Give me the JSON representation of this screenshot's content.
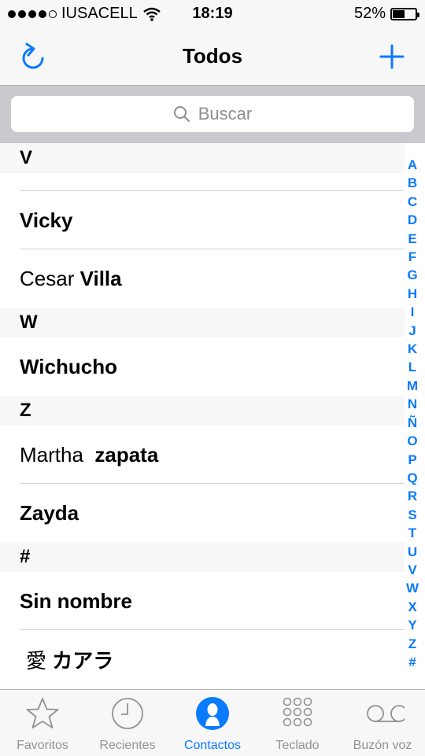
{
  "status": {
    "carrier": "IUSACELL",
    "time": "18:19",
    "battery": "52%",
    "battery_level": 0.52
  },
  "nav": {
    "title": "Todos"
  },
  "search": {
    "placeholder": "Buscar"
  },
  "sections": [
    {
      "header": "V",
      "rows": [
        {
          "first": "",
          "last": "",
          "short": true
        },
        {
          "first": "",
          "last": "Vicky"
        },
        {
          "first": "Cesar",
          "last": "Villa"
        }
      ]
    },
    {
      "header": "W",
      "rows": [
        {
          "first": "",
          "last": "Wichucho"
        }
      ]
    },
    {
      "header": "Z",
      "rows": [
        {
          "first": "Martha",
          "last": "zapata"
        },
        {
          "first": "",
          "last": "Zayda"
        }
      ]
    },
    {
      "header": "#",
      "rows": [
        {
          "first": "",
          "last": "Sin nombre"
        },
        {
          "first": "愛",
          "last": "カアラ"
        }
      ]
    }
  ],
  "index": [
    "A",
    "B",
    "C",
    "D",
    "E",
    "F",
    "G",
    "H",
    "I",
    "J",
    "K",
    "L",
    "M",
    "N",
    "Ñ",
    "O",
    "P",
    "Q",
    "R",
    "S",
    "T",
    "U",
    "V",
    "W",
    "X",
    "Y",
    "Z",
    "#"
  ],
  "tabs": [
    {
      "label": "Favoritos",
      "icon": "star-icon"
    },
    {
      "label": "Recientes",
      "icon": "clock-icon"
    },
    {
      "label": "Contactos",
      "icon": "contact-icon"
    },
    {
      "label": "Teclado",
      "icon": "keypad-icon"
    },
    {
      "label": "Buzón voz",
      "icon": "voicemail-icon"
    }
  ],
  "colors": {
    "accent": "#0a7aff",
    "inactive": "#929292"
  }
}
